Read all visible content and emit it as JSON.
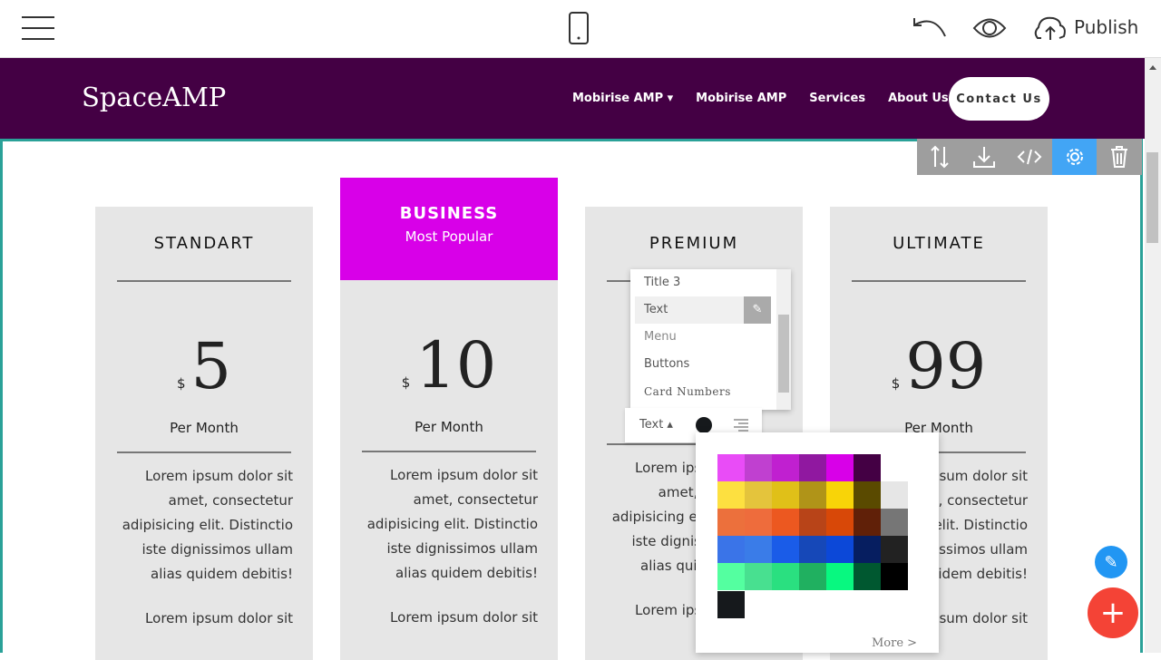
{
  "topbar": {
    "publish_label": "Publish",
    "icons": [
      "hamburger-icon",
      "mobile-icon",
      "undo-icon",
      "eye-icon",
      "cloud-upload-icon"
    ]
  },
  "nav": {
    "brand": "SpaceAMP",
    "links": [
      "Mobirise AMP",
      "Mobirise AMP",
      "Services",
      "About Us"
    ],
    "contact": "Contact Us",
    "bg": "#440044"
  },
  "block_tools": [
    "sort-icon",
    "download-icon",
    "code-icon",
    "gear-icon",
    "trash-icon"
  ],
  "cards": [
    {
      "title": "STANDART",
      "currency": "$",
      "price": "5",
      "period": "Per Month"
    },
    {
      "title": "BUSINESS",
      "subtitle": "Most Popular",
      "currency": "$",
      "price": "10",
      "period": "Per Month"
    },
    {
      "title": "PREMIUM",
      "currency": "$",
      "price": "",
      "period": ""
    },
    {
      "title": "ULTIMATE",
      "currency": "$",
      "price": "99",
      "period": "Per Month"
    }
  ],
  "lorem": [
    "Lorem ipsum dolor sit amet, consectetur adipisicing elit. Distinctio iste dignissimos ullam alias quidem debitis!",
    "Lorem ipsum dolor sit"
  ],
  "style_menu": {
    "items": [
      "Title 3",
      "Text",
      "Menu",
      "Buttons",
      "Card Numbers"
    ],
    "selected": "Text"
  },
  "text_toolbar": {
    "label": "Text"
  },
  "palette": {
    "rows": [
      [
        "#e94cf7",
        "#c040d0",
        "#c020d0",
        "#9018a0",
        "#d800e8",
        "#440044"
      ],
      [
        "#fde040",
        "#e4c43c",
        "#e0c018",
        "#b09418",
        "#f8d408",
        "#5a4a00",
        "#e6e6e6"
      ],
      [
        "#ec703c",
        "#ee6c3c",
        "#ec5820",
        "#b84418",
        "#d84808",
        "#602008",
        "#767676"
      ],
      [
        "#3a74e8",
        "#3a7ce8",
        "#1a5ce8",
        "#1648b8",
        "#0c48d8",
        "#061e60",
        "#222222"
      ],
      [
        "#54ffa0",
        "#48e090",
        "#2ae080",
        "#20b060",
        "#08f880",
        "#005830",
        "#000000"
      ],
      [
        "#16191c"
      ]
    ],
    "more": "More >"
  }
}
